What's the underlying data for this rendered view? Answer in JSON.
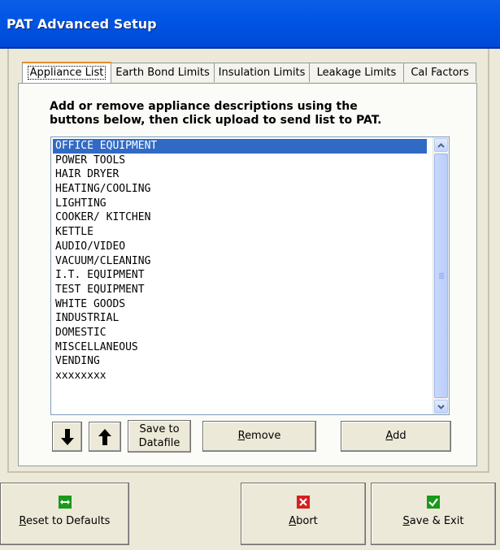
{
  "window": {
    "title": "PAT Advanced Setup"
  },
  "tabs": [
    {
      "label": "Appliance List",
      "active": true
    },
    {
      "label": "Earth Bond Limits",
      "active": false
    },
    {
      "label": "Insulation Limits",
      "active": false
    },
    {
      "label": "Leakage Limits",
      "active": false
    },
    {
      "label": "Cal Factors",
      "active": false
    }
  ],
  "panel": {
    "instruction_line1": "Add or remove appliance descriptions using the",
    "instruction_line2": "buttons below, then click upload to send list to PAT."
  },
  "appliance_list": {
    "selected_index": 0,
    "items": [
      "OFFICE EQUIPMENT",
      "POWER TOOLS",
      "HAIR DRYER",
      "HEATING/COOLING",
      "LIGHTING",
      "COOKER/ KITCHEN",
      "KETTLE",
      "AUDIO/VIDEO",
      "VACUUM/CLEANING",
      "I.T. EQUIPMENT",
      "TEST EQUIPMENT",
      "WHITE GOODS",
      "INDUSTRIAL",
      "DOMESTIC",
      "MISCELLANEOUS",
      "VENDING",
      "xxxxxxxx"
    ]
  },
  "list_buttons": {
    "move_down_icon": "down-arrow-icon",
    "move_up_icon": "up-arrow-icon",
    "save_line1": "Save to",
    "save_line2": "Datafile",
    "remove_first": "R",
    "remove_rest": "emove",
    "add_first": "A",
    "add_rest": "dd"
  },
  "bottom_buttons": {
    "reset_first": "R",
    "reset_rest": "eset to Defaults",
    "abort_first": "A",
    "abort_rest": "bort",
    "save_exit_first": "S",
    "save_exit_rest": "ave & Exit"
  },
  "colors": {
    "title_bar": "#0055e5",
    "selection": "#316ac5",
    "reset_icon": "#1a9a1a",
    "abort_icon": "#d42020",
    "save_icon": "#1a9a1a"
  }
}
